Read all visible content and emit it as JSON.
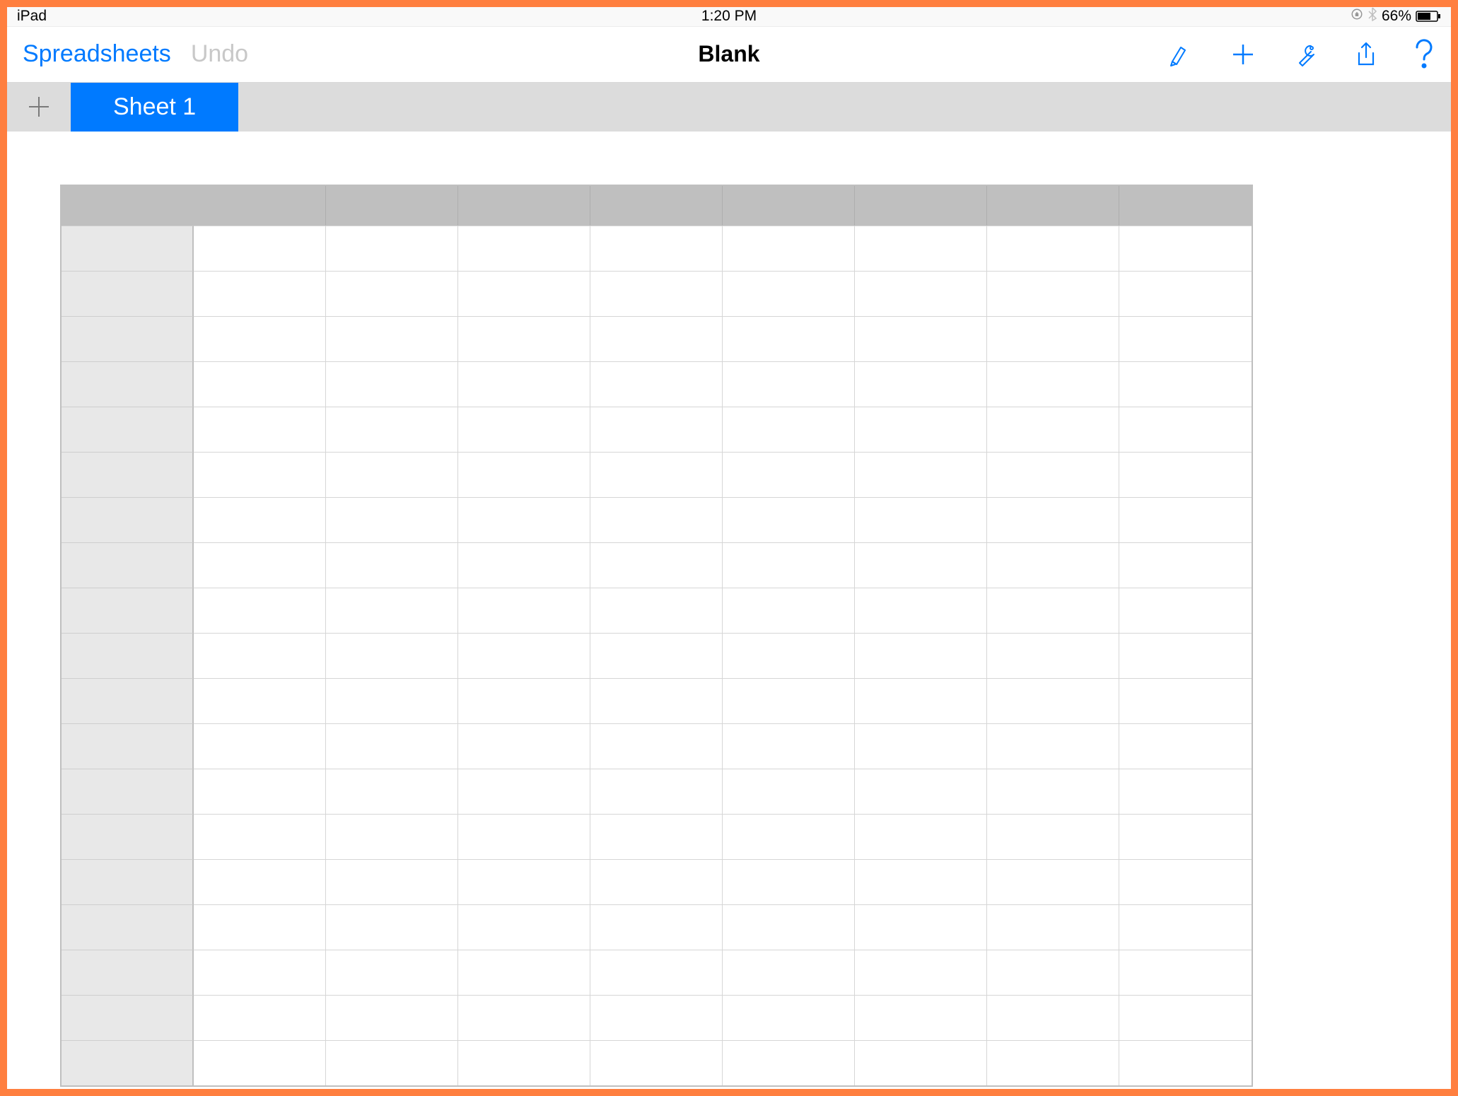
{
  "status_bar": {
    "device": "iPad",
    "time": "1:20 PM",
    "lock_icon": "orientation-lock-icon",
    "bluetooth_icon": "bluetooth-icon",
    "battery_percent": "66%",
    "battery_icon": "battery-icon"
  },
  "toolbar": {
    "back_label": "Spreadsheets",
    "undo_label": "Undo",
    "title": "Blank",
    "icons": {
      "brush": "brush-icon",
      "add": "plus-icon",
      "wrench": "wrench-icon",
      "share": "share-icon",
      "help": "help-icon"
    }
  },
  "sheet_tabs": {
    "add_icon": "plus-icon",
    "tabs": [
      {
        "label": "Sheet 1",
        "active": true
      }
    ]
  },
  "grid": {
    "columns": 9,
    "rows": 19,
    "column_headers": [
      "",
      "",
      "",
      "",
      "",
      "",
      "",
      "",
      ""
    ],
    "row_headers": [
      "",
      "",
      "",
      "",
      "",
      "",
      "",
      "",
      "",
      "",
      "",
      "",
      "",
      "",
      "",
      "",
      "",
      "",
      ""
    ],
    "cells": []
  },
  "colors": {
    "accent": "#007aff",
    "frame": "#ff7f3f",
    "tab_bg": "#dcdcdc",
    "grid_header": "#bfbfbf",
    "row_header": "#e8e8e8"
  }
}
